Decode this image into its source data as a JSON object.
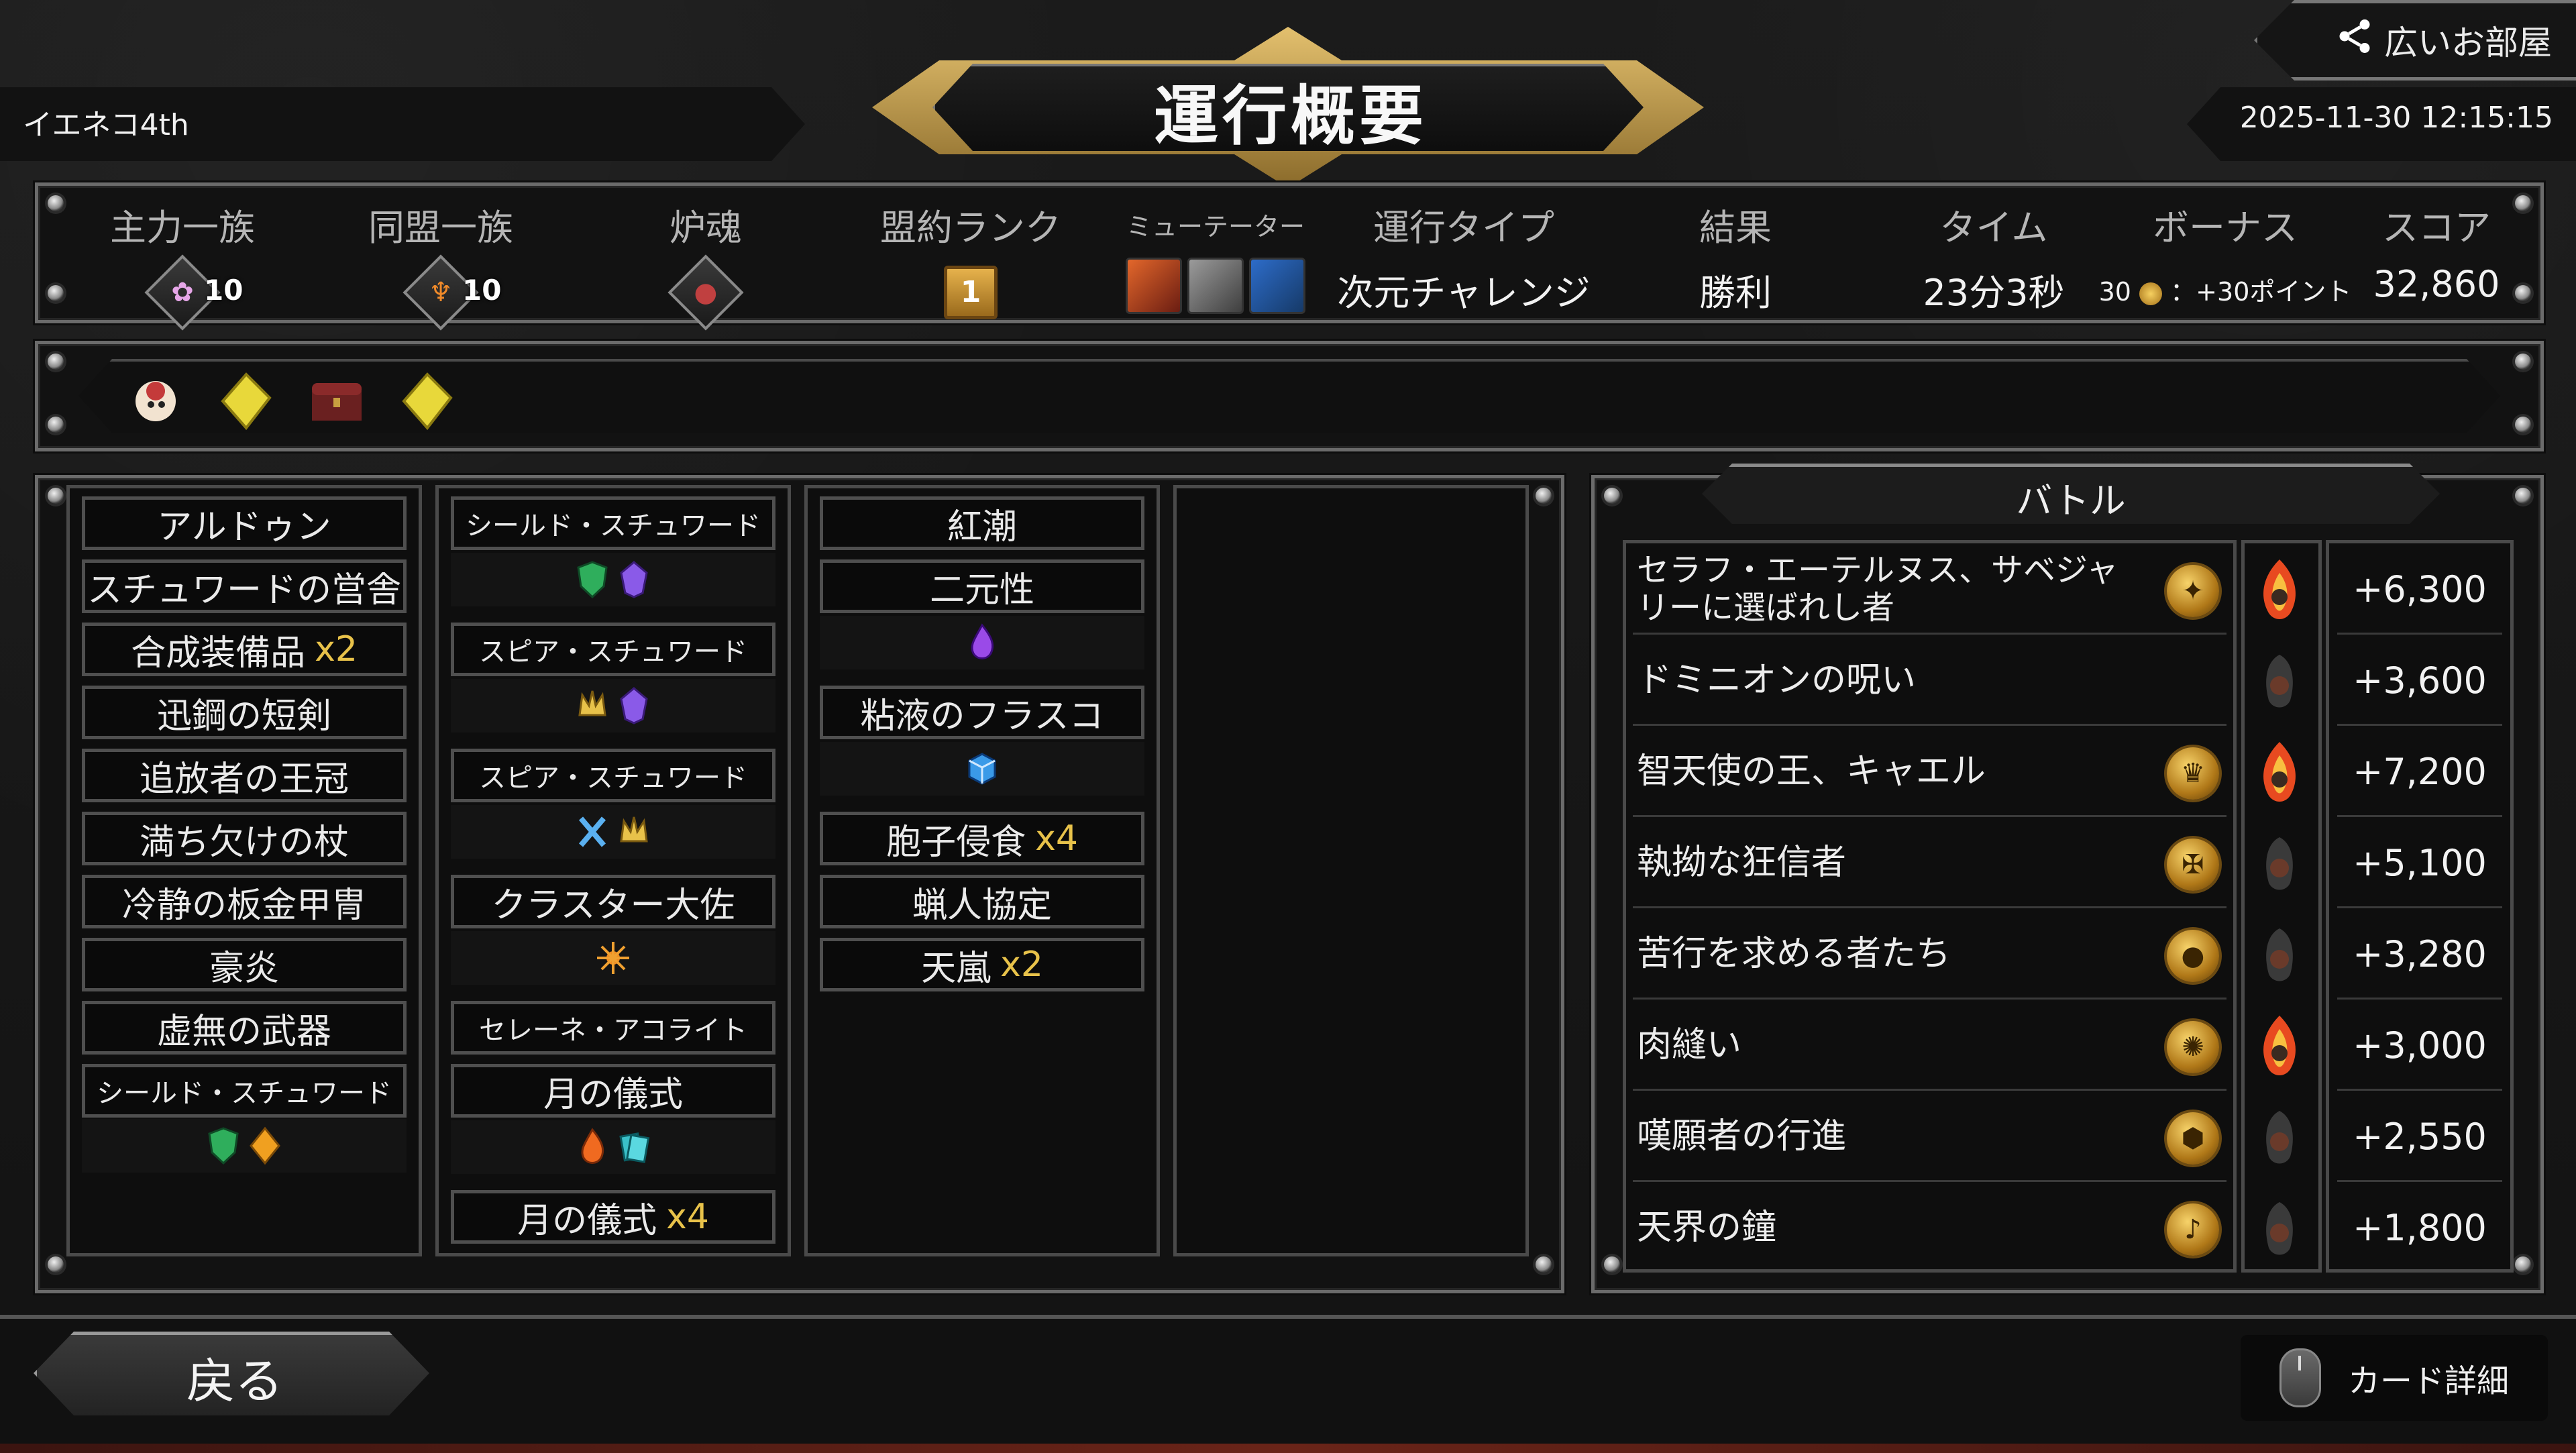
{
  "header": {
    "title": "運行概要",
    "player_name": "イエネコ4th",
    "datetime": "2025-11-30 12:15:15",
    "share_label": "広いお部屋",
    "share_icon": "share-icon"
  },
  "stats": {
    "labels": {
      "main_clan": "主力一族",
      "allied_clan": "同盟一族",
      "pyre": "炉魂",
      "covenant": "盟約ランク",
      "mutators": "ミューテーター",
      "run_type": "運行タイプ",
      "result": "結果",
      "time": "タイム",
      "bonus": "ボーナス",
      "score": "スコア"
    },
    "main_clan_level": "10",
    "allied_clan_level": "10",
    "covenant_rank": "1",
    "run_type": "次元チャレンジ",
    "result": "勝利",
    "time": "23分3秒",
    "bonus_count": "30",
    "bonus_points": "：+30ポイント",
    "score": "32,860"
  },
  "relics": [
    "clown-relic-icon",
    "yellow-crystal-relic-icon",
    "treasure-chest-relic-icon",
    "yellow-crystal-relic-icon"
  ],
  "deck": {
    "col1": {
      "c1": "アルドゥン",
      "c2": "スチュワードの営舎",
      "c3": "合成装備品",
      "c3x": "x2",
      "c4": "迅鋼の短剣",
      "c5": "追放者の王冠",
      "c6": "満ち欠けの杖",
      "c7": "冷静の板金甲冑",
      "c8": "豪炎",
      "c9": "虚無の武器",
      "c10": "シールド・スチュワード"
    },
    "col2": {
      "c1": "シールド・スチュワード",
      "c2": "スピア・スチュワード",
      "c3": "スピア・スチュワード",
      "c4": "クラスター大佐",
      "c5": "セレーネ・アコライト",
      "c6": "月の儀式",
      "c7": "月の儀式",
      "c7x": "x4"
    },
    "col3": {
      "c1": "紅潮",
      "c2": "二元性",
      "c3": "粘液のフラスコ",
      "c4": "胞子侵食",
      "c4x": "x4",
      "c5": "蝋人協定",
      "c6": "天嵐",
      "c6x": "x2"
    }
  },
  "battle": {
    "tab_label": "バトル",
    "rows": [
      {
        "name": "セラフ・エーテルヌス、サベジャリーに選ばれし者",
        "score": "+6,300"
      },
      {
        "name": "ドミニオンの呪い",
        "score": "+3,600"
      },
      {
        "name": "智天使の王、キャエル",
        "score": "+7,200"
      },
      {
        "name": "執拗な狂信者",
        "score": "+5,100"
      },
      {
        "name": "苦行を求める者たち",
        "score": "+3,280"
      },
      {
        "name": "肉縫い",
        "score": "+3,000"
      },
      {
        "name": "嘆願者の行進",
        "score": "+2,550"
      },
      {
        "name": "天界の鐘",
        "score": "+1,800"
      }
    ]
  },
  "footer": {
    "back_label": "戻る",
    "card_detail_label": "カード詳細"
  },
  "colors": {
    "accent_gold": "#e8c24a",
    "panel_border": "#6b6b6b"
  }
}
